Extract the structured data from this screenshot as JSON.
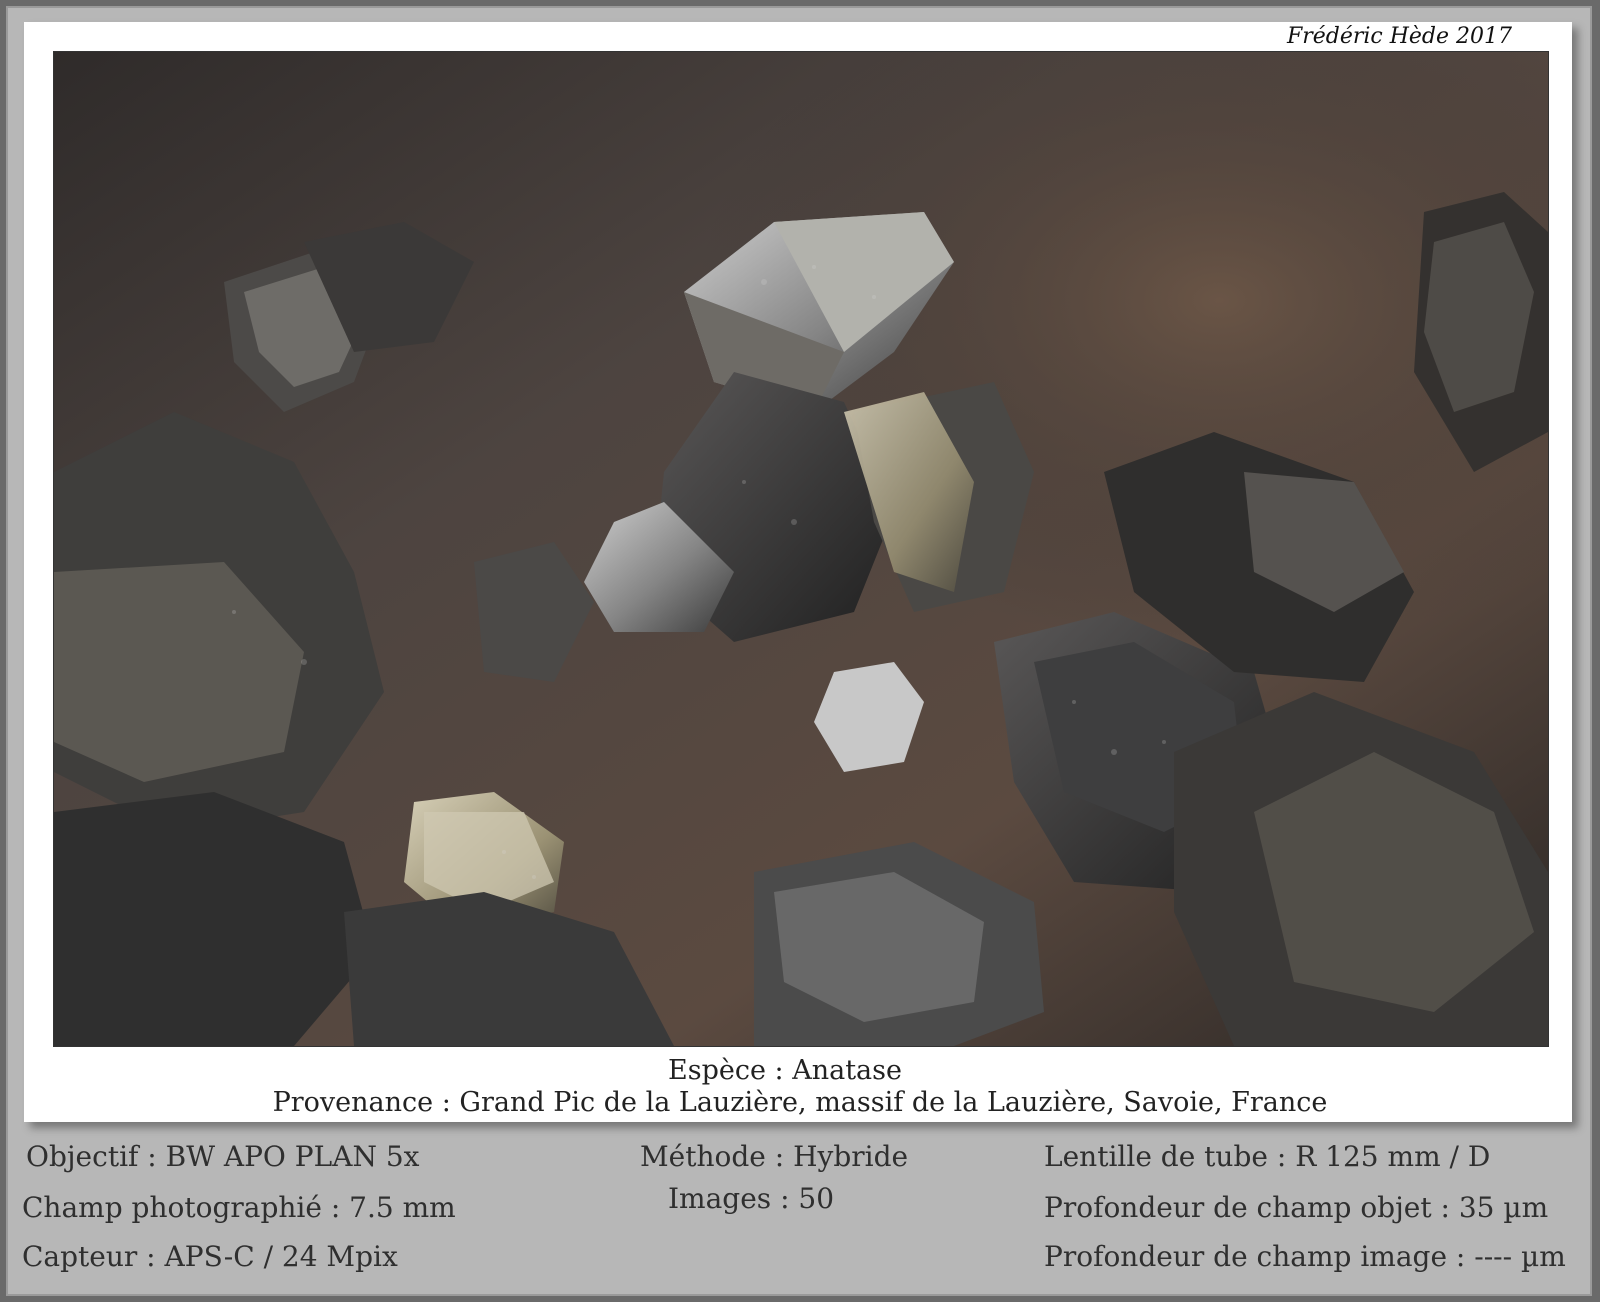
{
  "signature": "Frédéric Hède 2017",
  "photo": {
    "subject": "anatase-crystal-photomicrograph"
  },
  "caption": {
    "species": "Espèce : Anatase",
    "provenance": "Provenance : Grand Pic de la Lauzière, massif de la Lauzière, Savoie, France"
  },
  "info": {
    "objective": "Objectif : BW APO PLAN 5x",
    "field": "Champ photographié : 7.5 mm",
    "sensor": "Capteur : APS-C / 24 Mpix",
    "method": "Méthode : Hybride",
    "images": "Images : 50",
    "tube_lens": "Lentille de tube : R 125 mm / D",
    "object_dof": "Profondeur de champ objet : 35 µm",
    "image_dof": "Profondeur de champ image : ---- µm"
  },
  "colors": {
    "background": "#6a6a6a",
    "panel": "#b7b7b7",
    "card": "#ffffff",
    "text": "#2f2f2f"
  }
}
